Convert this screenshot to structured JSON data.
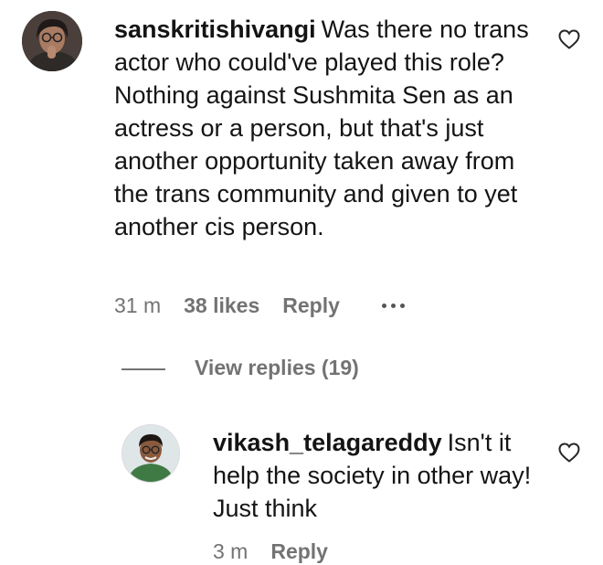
{
  "comments": [
    {
      "username": "sanskritishivangi",
      "text": "Was there no trans actor who could've played this role? Nothing against Sushmita Sen as an actress or a person, but that's just another opportunity taken away from the trans community and given to yet another cis person.",
      "time": "31 m",
      "likes": "38 likes",
      "reply_label": "Reply",
      "icons": {
        "like": "heart-outline-icon",
        "more": "more-options-icon"
      }
    }
  ],
  "replies_toggle": {
    "label": "View replies (19)"
  },
  "reply_comment": {
    "username": "vikash_telagareddy",
    "text": "Isn't it help the society in other way! Just think",
    "time": "3 m",
    "reply_label": "Reply",
    "icons": {
      "like": "heart-outline-icon"
    }
  },
  "colors": {
    "text": "#141414",
    "meta": "#737373",
    "background": "#ffffff"
  }
}
